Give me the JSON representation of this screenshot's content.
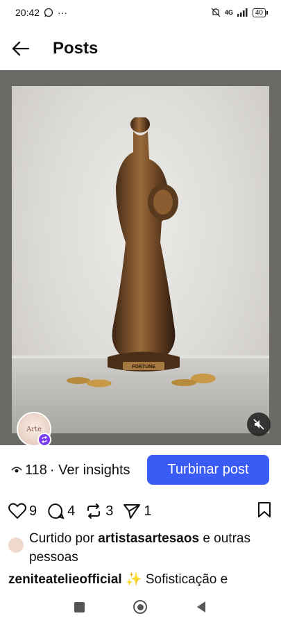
{
  "status": {
    "time": "20:42",
    "network": "4G",
    "battery": "40"
  },
  "header": {
    "title": "Posts"
  },
  "post": {
    "views": "118",
    "insights_link": "· Ver insights",
    "boost_label": "Turbinar post",
    "likes": "9",
    "comments": "4",
    "reposts": "3",
    "shares": "1",
    "liked_prefix": "Curtido por ",
    "liked_user": "artistasartesaos",
    "liked_suffix": " e outras pessoas",
    "caption_user": "zeniteatelieofficial",
    "caption_text": " ✨ Sofisticação e",
    "statue_label": "FORTUNE",
    "avatar_text": "Arte"
  },
  "colors": {
    "accent": "#3b5bf5",
    "badge": "#7a3cf0"
  }
}
